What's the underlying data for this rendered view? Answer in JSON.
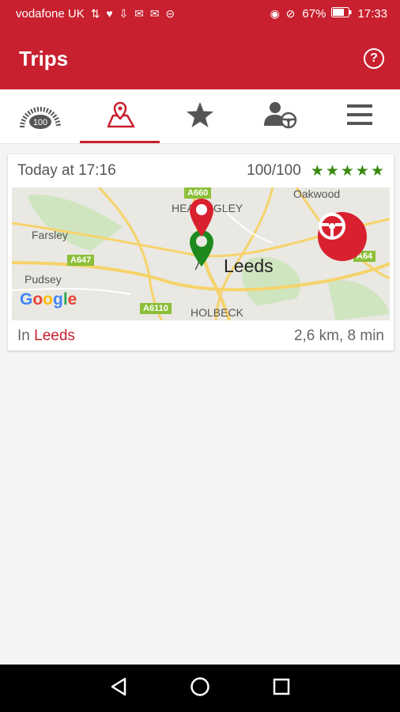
{
  "status_bar": {
    "carrier": "vodafone UK",
    "battery": "67%",
    "time": "17:33"
  },
  "app_bar": {
    "title": "Trips",
    "help_glyph": "?"
  },
  "tabs": [
    {
      "icon": "score-gauge-icon",
      "badge": "100"
    },
    {
      "icon": "map-pin-icon",
      "active": true
    },
    {
      "icon": "star-icon"
    },
    {
      "icon": "driver-profile-icon"
    },
    {
      "icon": "menu-icon"
    }
  ],
  "trip": {
    "time": "Today at 17:16",
    "score": "100/100",
    "stars": "★★★★★",
    "location_prefix": "In ",
    "location": "Leeds",
    "stats": "2,6 km, 8 min"
  },
  "map": {
    "labels": {
      "headingley": "HEADINGLEY",
      "oakwood": "Oakwood",
      "farsley": "Farsley",
      "pudsey": "Pudsey",
      "holbeck": "HOLBECK",
      "city": "Leeds"
    },
    "roads": {
      "a660": "A660",
      "a647": "A647",
      "a64": "A64",
      "a6110": "A6110"
    },
    "google": [
      "G",
      "o",
      "o",
      "g",
      "l",
      "e"
    ],
    "colors": {
      "start_pin": "#1e8a1e",
      "end_pin": "#d8202f",
      "road": "#f6d36a"
    }
  },
  "colors": {
    "brand": "#c8202f",
    "stars": "#3a8a10"
  }
}
